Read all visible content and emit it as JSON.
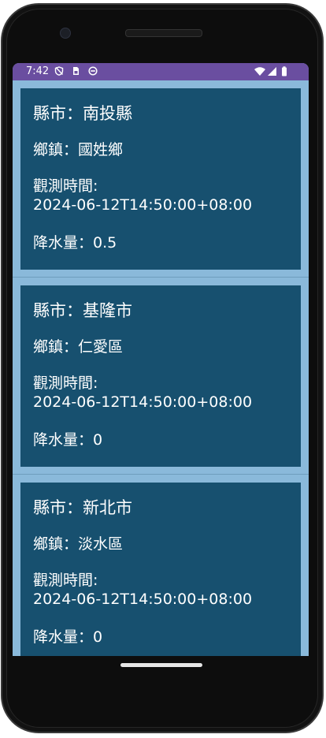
{
  "status_bar": {
    "time": "7:42",
    "left_icons": [
      "shield-off-icon",
      "sim-card-icon",
      "app-circle-icon"
    ],
    "right_icons": [
      "wifi-icon",
      "signal-icon",
      "battery-icon"
    ]
  },
  "colors": {
    "status_bar": "#6a4ea0",
    "screen_background": "#8ab9da",
    "card_background": "#17506f",
    "text": "#ffffff"
  },
  "records": [
    {
      "county": "縣市：南投縣",
      "town": "鄉鎮：國姓鄉",
      "time_label": "觀測時間:",
      "time_value": "2024-06-12T14:50:00+08:00",
      "rainfall": "降水量：0.5"
    },
    {
      "county": "縣市：基隆市",
      "town": "鄉鎮：仁愛區",
      "time_label": "觀測時間:",
      "time_value": "2024-06-12T14:50:00+08:00",
      "rainfall": "降水量：0"
    },
    {
      "county": "縣市：新北市",
      "town": "鄉鎮：淡水區",
      "time_label": "觀測時間:",
      "time_value": "2024-06-12T14:50:00+08:00",
      "rainfall": "降水量：0"
    }
  ]
}
